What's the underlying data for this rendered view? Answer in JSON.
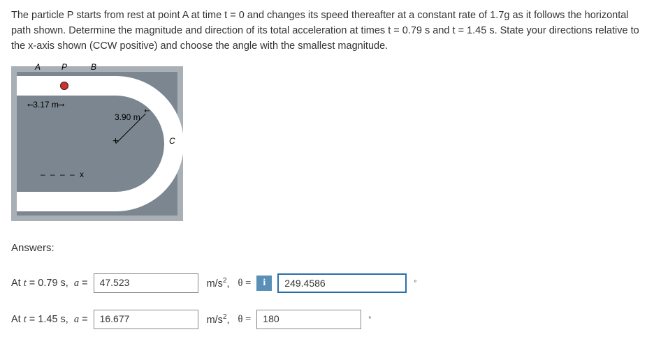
{
  "problem": {
    "text": "The particle P starts from rest at point A at time t = 0 and changes its speed thereafter at a constant rate of 1.7g as it follows the horizontal path shown. Determine the magnitude and direction of its total acceleration at times t = 0.79 s and t = 1.45 s. State your directions relative to the x-axis shown (CCW positive) and choose the angle with the smallest magnitude."
  },
  "diagram": {
    "labels": {
      "A": "A",
      "P": "P",
      "B": "B",
      "C": "C"
    },
    "dim_ab": "3.17 m",
    "radius": "3.90 m",
    "xaxis": "– – – – x"
  },
  "answers": {
    "heading": "Answers:",
    "row1": {
      "prefix": "At t = 0.79 s,",
      "a_label": "a =",
      "a_value": "47.523",
      "unit": "m/s²,",
      "theta_label": "θ =",
      "theta_value": "249.4586",
      "has_badge": true,
      "active": true
    },
    "row2": {
      "prefix": "At t = 1.45 s,",
      "a_label": "a =",
      "a_value": "16.677",
      "unit": "m/s²,",
      "theta_label": "θ =",
      "theta_value": "180",
      "has_badge": false,
      "active": false
    },
    "badge": "i",
    "degree": "°"
  }
}
